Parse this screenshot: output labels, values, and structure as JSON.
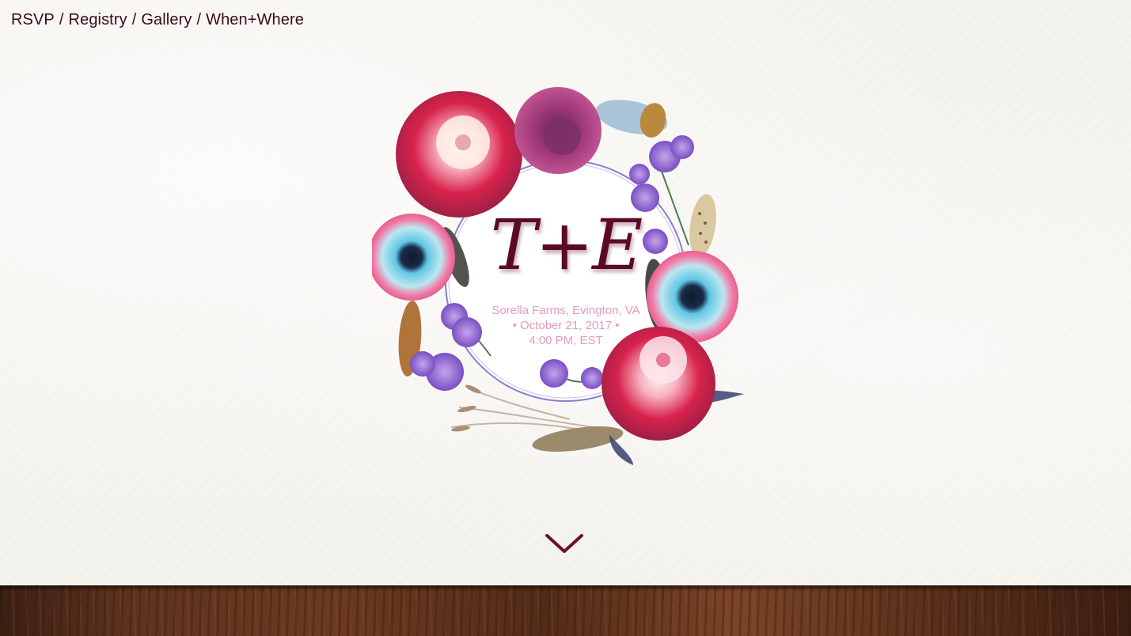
{
  "nav": {
    "items": [
      {
        "label": "RSVP"
      },
      {
        "label": "Registry"
      },
      {
        "label": "Gallery"
      },
      {
        "label": "When+Where"
      }
    ],
    "separator": "/"
  },
  "hero": {
    "monogram": "T+E",
    "venue": "Sorella Farms, Evington, VA",
    "date": "• October 21, 2017 •",
    "time": "4:00 PM, EST"
  },
  "colors": {
    "nav_text": "#3a0a1c",
    "monogram": "#5a0a26",
    "details_text": "#e79ac0",
    "chevron": "#6b0f2e"
  },
  "icons": {
    "scroll_down": "chevron-down-icon",
    "wreath": "floral-wreath-illustration"
  }
}
